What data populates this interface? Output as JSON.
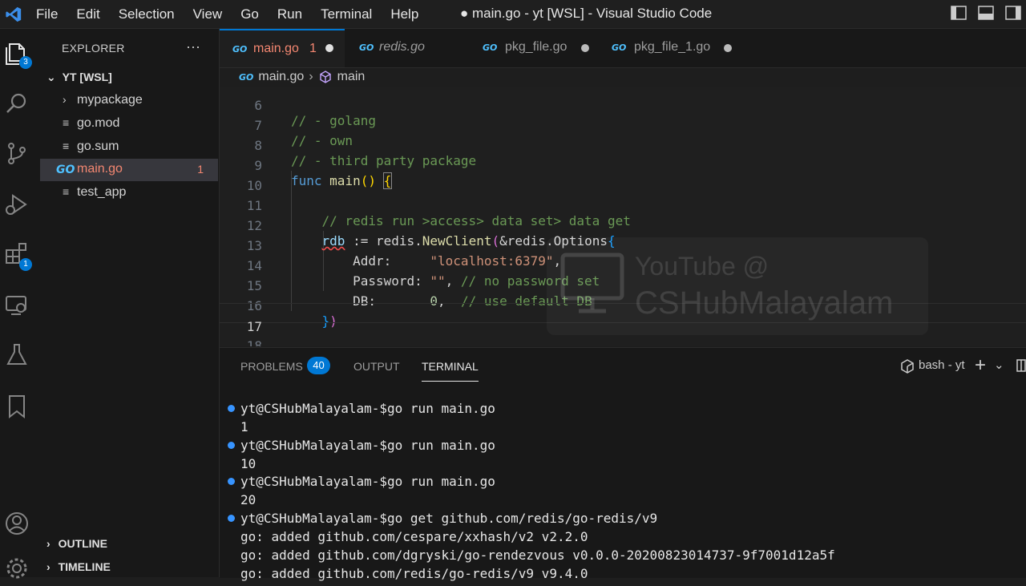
{
  "titlebar": {
    "menu": [
      "File",
      "Edit",
      "Selection",
      "View",
      "Go",
      "Run",
      "Terminal",
      "Help"
    ],
    "title": "● main.go - yt [WSL] - Visual Studio Code"
  },
  "activity": {
    "explorer_badge": "3",
    "extensions_badge": "1"
  },
  "sidebar": {
    "header": "EXPLORER",
    "more": "···",
    "root": "YT [WSL]",
    "items": [
      {
        "label": "mypackage"
      },
      {
        "label": "go.mod"
      },
      {
        "label": "go.sum"
      },
      {
        "label": "main.go",
        "count": "1"
      },
      {
        "label": "test_app"
      }
    ],
    "outline": "OUTLINE",
    "timeline": "TIMELINE"
  },
  "tabs": [
    {
      "label": "main.go",
      "problems": "1"
    },
    {
      "label": "redis.go"
    },
    {
      "label": "pkg_file.go"
    },
    {
      "label": "pkg_file_1.go"
    }
  ],
  "gomark": "GO",
  "breadcrumb": {
    "file": "main.go",
    "symbol": "main"
  },
  "editor": {
    "lines": [
      {
        "n": "6",
        "text": "// - golang"
      },
      {
        "n": "7",
        "text": "// - own"
      },
      {
        "n": "8",
        "text": "// - third party package"
      },
      {
        "n": "9",
        "text": "func main() {"
      },
      {
        "n": "10",
        "text": ""
      },
      {
        "n": "11",
        "text": "    // redis run >access> data set> data get"
      },
      {
        "n": "12",
        "text": "    rdb := redis.NewClient(&redis.Options{"
      },
      {
        "n": "13",
        "text": "        Addr:     \"localhost:6379\","
      },
      {
        "n": "14",
        "text": "        Password: \"\", // no password set"
      },
      {
        "n": "15",
        "text": "        DB:       0,  // use default DB"
      },
      {
        "n": "16",
        "text": "    })"
      },
      {
        "n": "17",
        "text": ""
      },
      {
        "n": "18",
        "text": "}"
      }
    ]
  },
  "watermark": {
    "line1": "YouTube @",
    "line2": "CSHubMalayalam"
  },
  "panel": {
    "problems": "PROBLEMS",
    "problems_count": "40",
    "output": "OUTPUT",
    "terminal": "TERMINAL",
    "shell": "bash - yt",
    "lines": [
      {
        "prompt": true,
        "text": "yt@CSHubMalayalam-$go run main.go"
      },
      {
        "prompt": false,
        "text": "1"
      },
      {
        "prompt": true,
        "text": "yt@CSHubMalayalam-$go run main.go"
      },
      {
        "prompt": false,
        "text": "10"
      },
      {
        "prompt": true,
        "text": "yt@CSHubMalayalam-$go run main.go"
      },
      {
        "prompt": false,
        "text": "20"
      },
      {
        "prompt": true,
        "text": "yt@CSHubMalayalam-$go get github.com/redis/go-redis/v9"
      },
      {
        "prompt": false,
        "text": "go: added github.com/cespare/xxhash/v2 v2.2.0"
      },
      {
        "prompt": false,
        "text": "go: added github.com/dgryski/go-rendezvous v0.0.0-20200823014737-9f7001d12a5f"
      },
      {
        "prompt": false,
        "text": "go: added github.com/redis/go-redis/v9 v9.4.0"
      }
    ]
  },
  "colors": {
    "accent": "#0078d4",
    "error": "#f48771",
    "background": "#1e1e1e"
  }
}
